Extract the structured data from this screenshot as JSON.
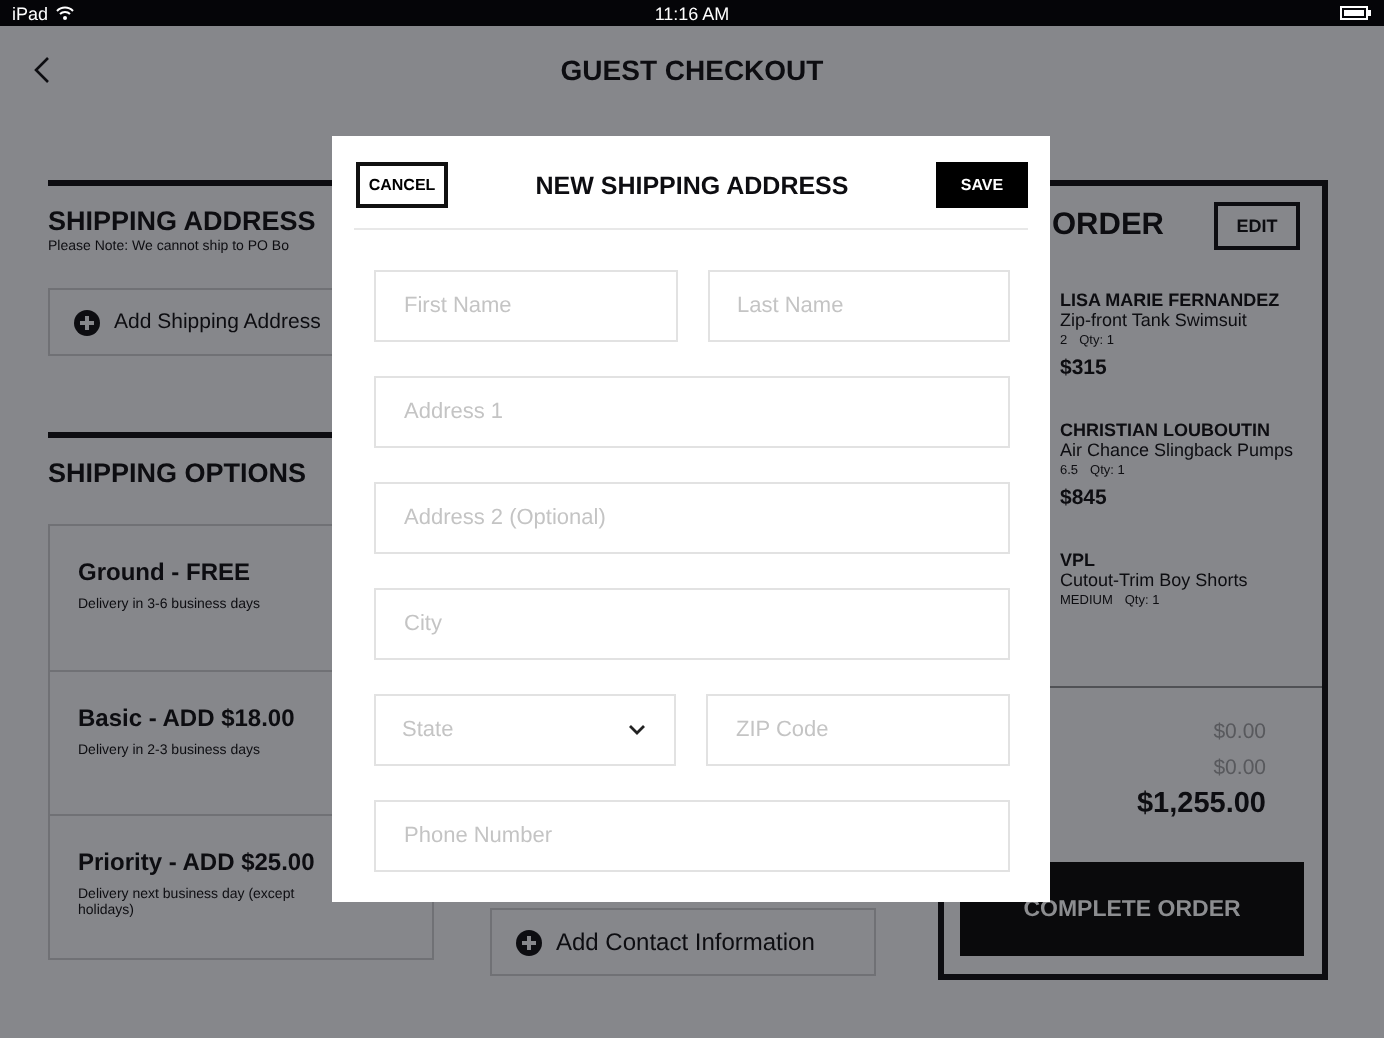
{
  "status_bar": {
    "device": "iPad",
    "time": "11:16 AM"
  },
  "header": {
    "title": "GUEST CHECKOUT"
  },
  "shipping_address": {
    "title": "SHIPPING ADDRESS",
    "note": "Please Note: We cannot ship to PO Bo",
    "add_button": "Add Shipping Address"
  },
  "shipping_options": {
    "title": "SHIPPING OPTIONS",
    "options": [
      {
        "title": "Ground - FREE",
        "description": "Delivery in 3-6 business days"
      },
      {
        "title": "Basic - ADD $18.00",
        "description": "Delivery in 2-3 business days"
      },
      {
        "title": "Priority - ADD $25.00",
        "description": "Delivery next business day (except holidays)"
      }
    ]
  },
  "contact": {
    "add_button": "Add Contact Information"
  },
  "order": {
    "title": "ORDER",
    "edit_button": "EDIT",
    "items": [
      {
        "brand": "LISA MARIE FERNANDEZ",
        "name": "Zip-front Tank Swimsuit",
        "size": "2",
        "qty": "Qty: 1",
        "price": "$315"
      },
      {
        "brand": "CHRISTIAN LOUBOUTIN",
        "name": "Air Chance Slingback Pumps",
        "size": "6.5",
        "qty": "Qty: 1",
        "price": "$845"
      },
      {
        "brand": "VPL",
        "name": "Cutout-Trim Boy Shorts",
        "size": "MEDIUM",
        "qty": "Qty: 1"
      }
    ],
    "totals": [
      {
        "kind": "minor",
        "amount": "$0.00"
      },
      {
        "kind": "minor",
        "amount": "$0.00"
      },
      {
        "kind": "total",
        "amount": "$1,255.00"
      }
    ],
    "complete_button": "COMPLETE ORDER"
  },
  "modal": {
    "title": "NEW SHIPPING ADDRESS",
    "cancel_button": "CANCEL",
    "save_button": "SAVE",
    "rows": [
      [
        {
          "kind": "text",
          "placeholder": "First Name"
        },
        {
          "kind": "text",
          "placeholder": "Last Name"
        }
      ],
      [
        {
          "kind": "text",
          "placeholder": "Address 1"
        }
      ],
      [
        {
          "kind": "text",
          "placeholder": "Address 2 (Optional)"
        }
      ],
      [
        {
          "kind": "text",
          "placeholder": "City"
        }
      ],
      [
        {
          "kind": "select",
          "placeholder": "State"
        },
        {
          "kind": "text",
          "placeholder": "ZIP Code"
        }
      ],
      [
        {
          "kind": "text",
          "placeholder": "Phone Number"
        }
      ]
    ]
  }
}
